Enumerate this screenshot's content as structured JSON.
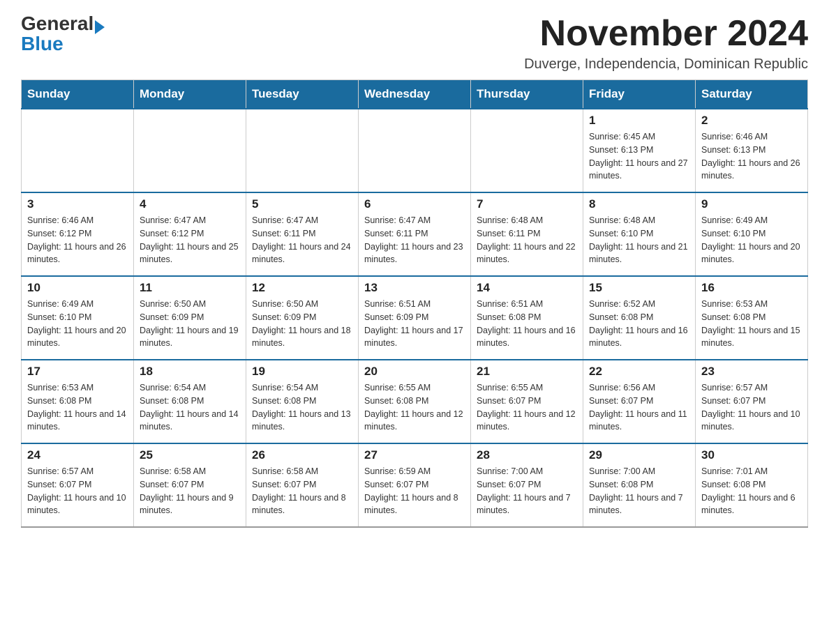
{
  "logo": {
    "general": "General",
    "blue": "Blue"
  },
  "title": "November 2024",
  "subtitle": "Duverge, Independencia, Dominican Republic",
  "days_of_week": [
    "Sunday",
    "Monday",
    "Tuesday",
    "Wednesday",
    "Thursday",
    "Friday",
    "Saturday"
  ],
  "weeks": [
    [
      {
        "day": "",
        "sunrise": "",
        "sunset": "",
        "daylight": ""
      },
      {
        "day": "",
        "sunrise": "",
        "sunset": "",
        "daylight": ""
      },
      {
        "day": "",
        "sunrise": "",
        "sunset": "",
        "daylight": ""
      },
      {
        "day": "",
        "sunrise": "",
        "sunset": "",
        "daylight": ""
      },
      {
        "day": "",
        "sunrise": "",
        "sunset": "",
        "daylight": ""
      },
      {
        "day": "1",
        "sunrise": "Sunrise: 6:45 AM",
        "sunset": "Sunset: 6:13 PM",
        "daylight": "Daylight: 11 hours and 27 minutes."
      },
      {
        "day": "2",
        "sunrise": "Sunrise: 6:46 AM",
        "sunset": "Sunset: 6:13 PM",
        "daylight": "Daylight: 11 hours and 26 minutes."
      }
    ],
    [
      {
        "day": "3",
        "sunrise": "Sunrise: 6:46 AM",
        "sunset": "Sunset: 6:12 PM",
        "daylight": "Daylight: 11 hours and 26 minutes."
      },
      {
        "day": "4",
        "sunrise": "Sunrise: 6:47 AM",
        "sunset": "Sunset: 6:12 PM",
        "daylight": "Daylight: 11 hours and 25 minutes."
      },
      {
        "day": "5",
        "sunrise": "Sunrise: 6:47 AM",
        "sunset": "Sunset: 6:11 PM",
        "daylight": "Daylight: 11 hours and 24 minutes."
      },
      {
        "day": "6",
        "sunrise": "Sunrise: 6:47 AM",
        "sunset": "Sunset: 6:11 PM",
        "daylight": "Daylight: 11 hours and 23 minutes."
      },
      {
        "day": "7",
        "sunrise": "Sunrise: 6:48 AM",
        "sunset": "Sunset: 6:11 PM",
        "daylight": "Daylight: 11 hours and 22 minutes."
      },
      {
        "day": "8",
        "sunrise": "Sunrise: 6:48 AM",
        "sunset": "Sunset: 6:10 PM",
        "daylight": "Daylight: 11 hours and 21 minutes."
      },
      {
        "day": "9",
        "sunrise": "Sunrise: 6:49 AM",
        "sunset": "Sunset: 6:10 PM",
        "daylight": "Daylight: 11 hours and 20 minutes."
      }
    ],
    [
      {
        "day": "10",
        "sunrise": "Sunrise: 6:49 AM",
        "sunset": "Sunset: 6:10 PM",
        "daylight": "Daylight: 11 hours and 20 minutes."
      },
      {
        "day": "11",
        "sunrise": "Sunrise: 6:50 AM",
        "sunset": "Sunset: 6:09 PM",
        "daylight": "Daylight: 11 hours and 19 minutes."
      },
      {
        "day": "12",
        "sunrise": "Sunrise: 6:50 AM",
        "sunset": "Sunset: 6:09 PM",
        "daylight": "Daylight: 11 hours and 18 minutes."
      },
      {
        "day": "13",
        "sunrise": "Sunrise: 6:51 AM",
        "sunset": "Sunset: 6:09 PM",
        "daylight": "Daylight: 11 hours and 17 minutes."
      },
      {
        "day": "14",
        "sunrise": "Sunrise: 6:51 AM",
        "sunset": "Sunset: 6:08 PM",
        "daylight": "Daylight: 11 hours and 16 minutes."
      },
      {
        "day": "15",
        "sunrise": "Sunrise: 6:52 AM",
        "sunset": "Sunset: 6:08 PM",
        "daylight": "Daylight: 11 hours and 16 minutes."
      },
      {
        "day": "16",
        "sunrise": "Sunrise: 6:53 AM",
        "sunset": "Sunset: 6:08 PM",
        "daylight": "Daylight: 11 hours and 15 minutes."
      }
    ],
    [
      {
        "day": "17",
        "sunrise": "Sunrise: 6:53 AM",
        "sunset": "Sunset: 6:08 PM",
        "daylight": "Daylight: 11 hours and 14 minutes."
      },
      {
        "day": "18",
        "sunrise": "Sunrise: 6:54 AM",
        "sunset": "Sunset: 6:08 PM",
        "daylight": "Daylight: 11 hours and 14 minutes."
      },
      {
        "day": "19",
        "sunrise": "Sunrise: 6:54 AM",
        "sunset": "Sunset: 6:08 PM",
        "daylight": "Daylight: 11 hours and 13 minutes."
      },
      {
        "day": "20",
        "sunrise": "Sunrise: 6:55 AM",
        "sunset": "Sunset: 6:08 PM",
        "daylight": "Daylight: 11 hours and 12 minutes."
      },
      {
        "day": "21",
        "sunrise": "Sunrise: 6:55 AM",
        "sunset": "Sunset: 6:07 PM",
        "daylight": "Daylight: 11 hours and 12 minutes."
      },
      {
        "day": "22",
        "sunrise": "Sunrise: 6:56 AM",
        "sunset": "Sunset: 6:07 PM",
        "daylight": "Daylight: 11 hours and 11 minutes."
      },
      {
        "day": "23",
        "sunrise": "Sunrise: 6:57 AM",
        "sunset": "Sunset: 6:07 PM",
        "daylight": "Daylight: 11 hours and 10 minutes."
      }
    ],
    [
      {
        "day": "24",
        "sunrise": "Sunrise: 6:57 AM",
        "sunset": "Sunset: 6:07 PM",
        "daylight": "Daylight: 11 hours and 10 minutes."
      },
      {
        "day": "25",
        "sunrise": "Sunrise: 6:58 AM",
        "sunset": "Sunset: 6:07 PM",
        "daylight": "Daylight: 11 hours and 9 minutes."
      },
      {
        "day": "26",
        "sunrise": "Sunrise: 6:58 AM",
        "sunset": "Sunset: 6:07 PM",
        "daylight": "Daylight: 11 hours and 8 minutes."
      },
      {
        "day": "27",
        "sunrise": "Sunrise: 6:59 AM",
        "sunset": "Sunset: 6:07 PM",
        "daylight": "Daylight: 11 hours and 8 minutes."
      },
      {
        "day": "28",
        "sunrise": "Sunrise: 7:00 AM",
        "sunset": "Sunset: 6:07 PM",
        "daylight": "Daylight: 11 hours and 7 minutes."
      },
      {
        "day": "29",
        "sunrise": "Sunrise: 7:00 AM",
        "sunset": "Sunset: 6:08 PM",
        "daylight": "Daylight: 11 hours and 7 minutes."
      },
      {
        "day": "30",
        "sunrise": "Sunrise: 7:01 AM",
        "sunset": "Sunset: 6:08 PM",
        "daylight": "Daylight: 11 hours and 6 minutes."
      }
    ]
  ]
}
